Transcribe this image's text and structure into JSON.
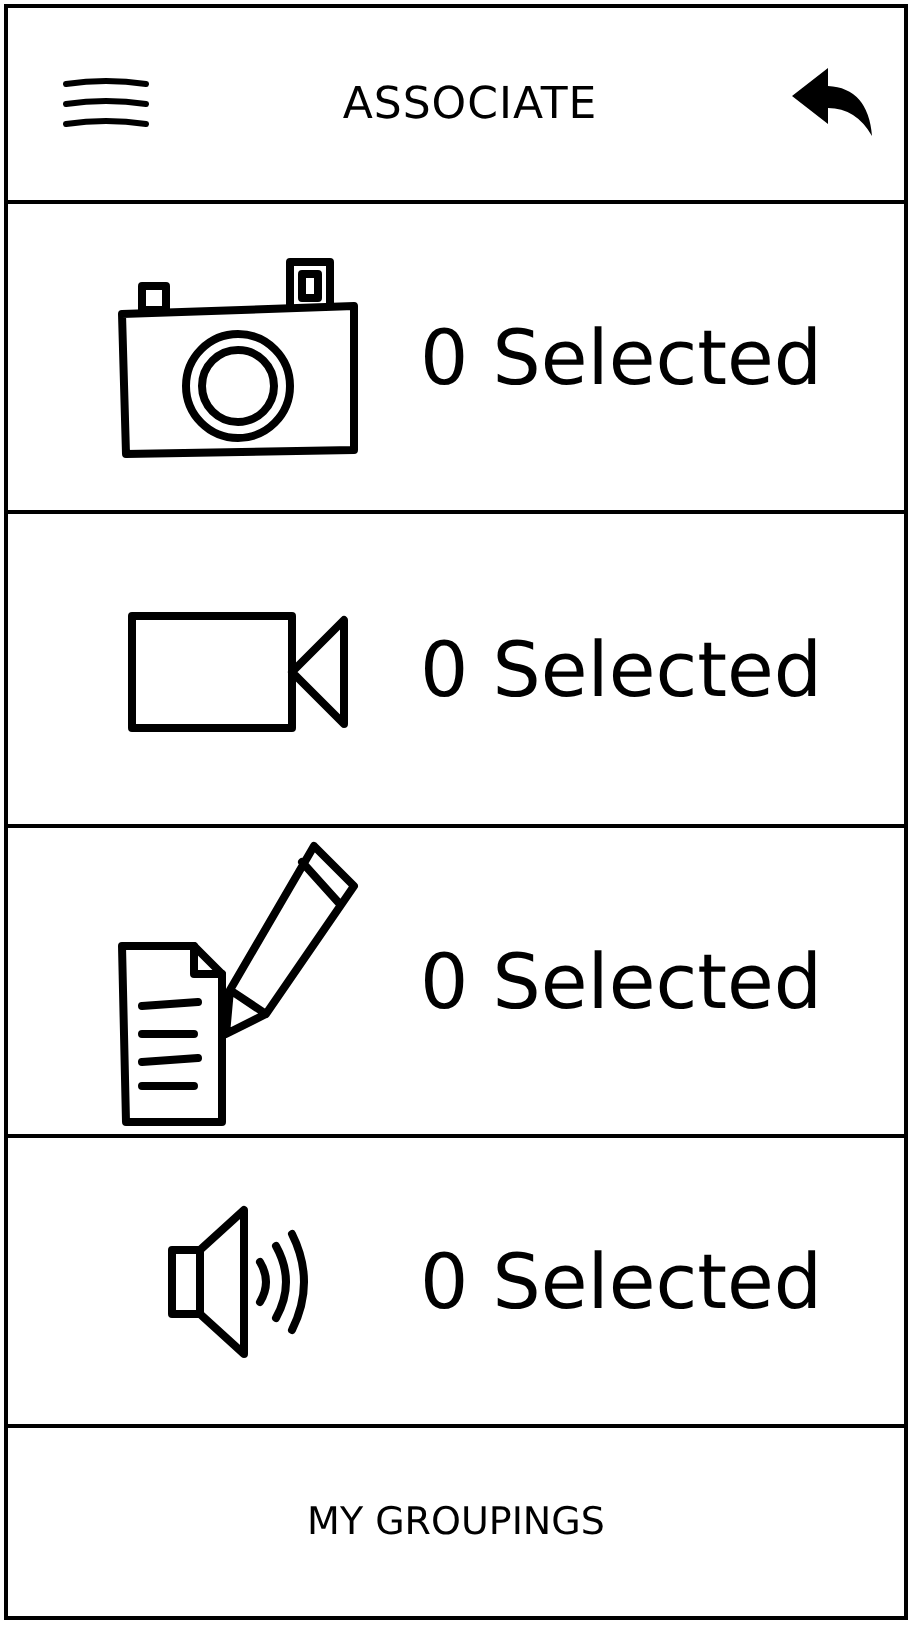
{
  "header": {
    "title": "ASSOCIATE"
  },
  "rows": [
    {
      "kind": "photo",
      "count": "0 Selected"
    },
    {
      "kind": "video",
      "count": "0 Selected"
    },
    {
      "kind": "note",
      "count": "0 Selected"
    },
    {
      "kind": "audio",
      "count": "0 Selected"
    }
  ],
  "footer": {
    "label": "MY GROUPINGS"
  }
}
